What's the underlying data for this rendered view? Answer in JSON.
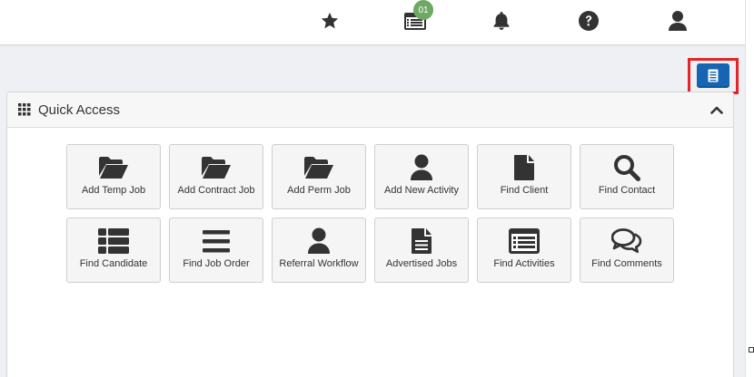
{
  "topbar": {
    "icons": [
      "star-icon",
      "calendar-list-icon",
      "bell-icon",
      "help-icon",
      "user-icon"
    ],
    "badge": "01"
  },
  "action_button": {
    "icon": "document-icon"
  },
  "quick_access": {
    "title": "Quick Access",
    "tiles": [
      {
        "label": "Add Temp Job",
        "icon": "folder-open-icon"
      },
      {
        "label": "Add Contract Job",
        "icon": "folder-open-icon"
      },
      {
        "label": "Add Perm Job",
        "icon": "folder-open-icon"
      },
      {
        "label": "Add New Activity",
        "icon": "user-icon"
      },
      {
        "label": "Find Client",
        "icon": "file-icon"
      },
      {
        "label": "Find Contact",
        "icon": "search-icon"
      },
      {
        "label": "Find Candidate",
        "icon": "list-thick-icon"
      },
      {
        "label": "Find Job Order",
        "icon": "bars-icon"
      },
      {
        "label": "Referral Workflow",
        "icon": "user-icon"
      },
      {
        "label": "Advertised Jobs",
        "icon": "file-text-icon"
      },
      {
        "label": "Find Activities",
        "icon": "list-alt-icon"
      },
      {
        "label": "Find Comments",
        "icon": "comments-icon"
      }
    ]
  },
  "colors": {
    "accent": "#1565b3",
    "badge": "#6fa863",
    "highlight": "#e52429",
    "icon": "#333333"
  }
}
